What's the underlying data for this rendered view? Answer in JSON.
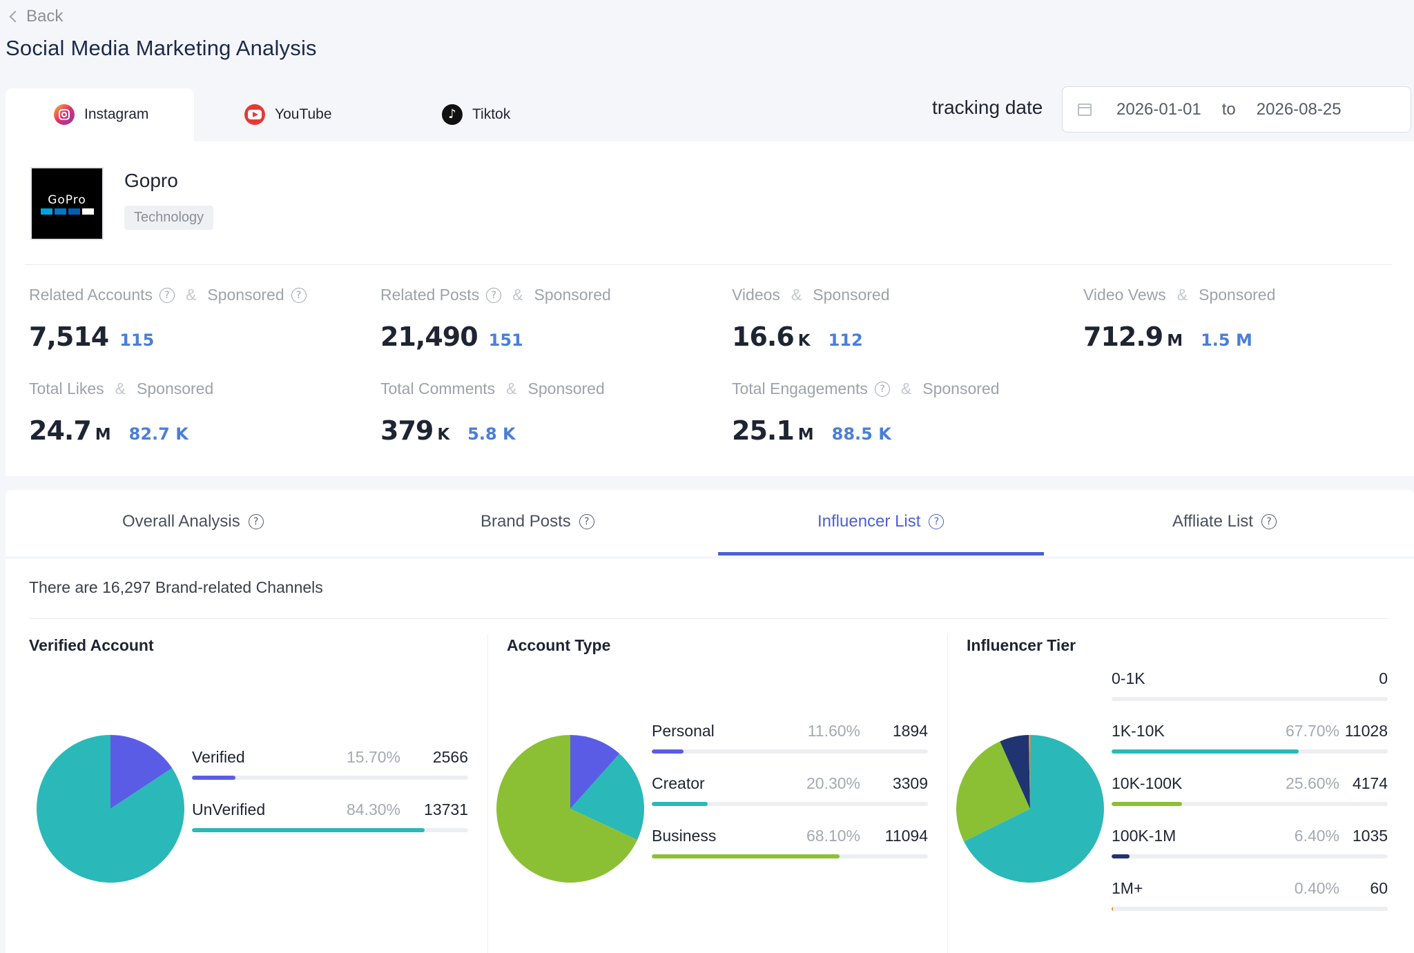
{
  "nav": {
    "back_label": "Back"
  },
  "page_title": "Social Media Marketing Analysis",
  "platforms": [
    {
      "label": "Instagram",
      "icon": "instagram-icon",
      "active": true
    },
    {
      "label": "YouTube",
      "icon": "youtube-icon",
      "active": false
    },
    {
      "label": "Tiktok",
      "icon": "tiktok-icon",
      "active": false
    }
  ],
  "tracking": {
    "label": "tracking date",
    "start": "2026-01-01",
    "separator": "to",
    "end": "2026-08-25"
  },
  "brand": {
    "name": "Gopro",
    "tag": "Technology",
    "logo_text": "GoPro"
  },
  "stats": [
    {
      "label": "Related Accounts",
      "sponsored_label": "Sponsored",
      "value": "7,514",
      "unit": "",
      "sponsored": "115"
    },
    {
      "label": "Related Posts",
      "sponsored_label": "Sponsored",
      "value": "21,490",
      "unit": "",
      "sponsored": "151"
    },
    {
      "label": "Videos",
      "sponsored_label": "Sponsored",
      "value": "16.6",
      "unit": "K",
      "sponsored": "112"
    },
    {
      "label": "Video Vews",
      "sponsored_label": "Sponsored",
      "value": "712.9",
      "unit": "M",
      "sponsored": "1.5 M"
    },
    {
      "label": "Total Likes",
      "sponsored_label": "Sponsored",
      "value": "24.7",
      "unit": "M",
      "sponsored": "82.7 K"
    },
    {
      "label": "Total Comments",
      "sponsored_label": "Sponsored",
      "value": "379",
      "unit": "K",
      "sponsored": "5.8 K"
    },
    {
      "label": "Total Engagements",
      "sponsored_label": "Sponsored",
      "value": "25.1",
      "unit": "M",
      "sponsored": "88.5 K"
    }
  ],
  "analysis_tabs": [
    {
      "label": "Overall Analysis",
      "active": false
    },
    {
      "label": "Brand Posts",
      "active": false
    },
    {
      "label": "Influencer List",
      "active": true
    },
    {
      "label": "Affliate List",
      "active": false
    }
  ],
  "channels_info": "There are 16,297 Brand-related Channels",
  "colors": {
    "accent": "#4b5fd8",
    "purple": "#5b5ce6",
    "teal": "#2bb8b8",
    "green": "#8cc034",
    "navy": "#1f3470",
    "orange": "#f08a24"
  },
  "chart_data": [
    {
      "type": "pie",
      "title": "Verified Account",
      "categories": [
        "Verified",
        "UnVerified"
      ],
      "percents": [
        "15.70%",
        "84.30%"
      ],
      "values": [
        2566,
        13731
      ],
      "fractions": [
        0.157,
        0.843
      ],
      "colors": [
        "#5b5ce6",
        "#2bb8b8"
      ]
    },
    {
      "type": "pie",
      "title": "Account Type",
      "categories": [
        "Personal",
        "Creator",
        "Business"
      ],
      "percents": [
        "11.60%",
        "20.30%",
        "68.10%"
      ],
      "values": [
        1894,
        3309,
        11094
      ],
      "fractions": [
        0.116,
        0.203,
        0.681
      ],
      "colors": [
        "#5b5ce6",
        "#2bb8b8",
        "#8cc034"
      ]
    },
    {
      "type": "pie",
      "title": "Influencer Tier",
      "categories": [
        "0-1K",
        "1K-10K",
        "10K-100K",
        "100K-1M",
        "1M+"
      ],
      "percents": [
        "",
        "67.70%",
        "25.60%",
        "6.40%",
        "0.40%"
      ],
      "values": [
        0,
        11028,
        4174,
        1035,
        60
      ],
      "fractions": [
        0,
        0.677,
        0.256,
        0.064,
        0.004
      ],
      "colors": [
        "#5b5ce6",
        "#2bb8b8",
        "#8cc034",
        "#1f3470",
        "#f08a24"
      ]
    }
  ]
}
